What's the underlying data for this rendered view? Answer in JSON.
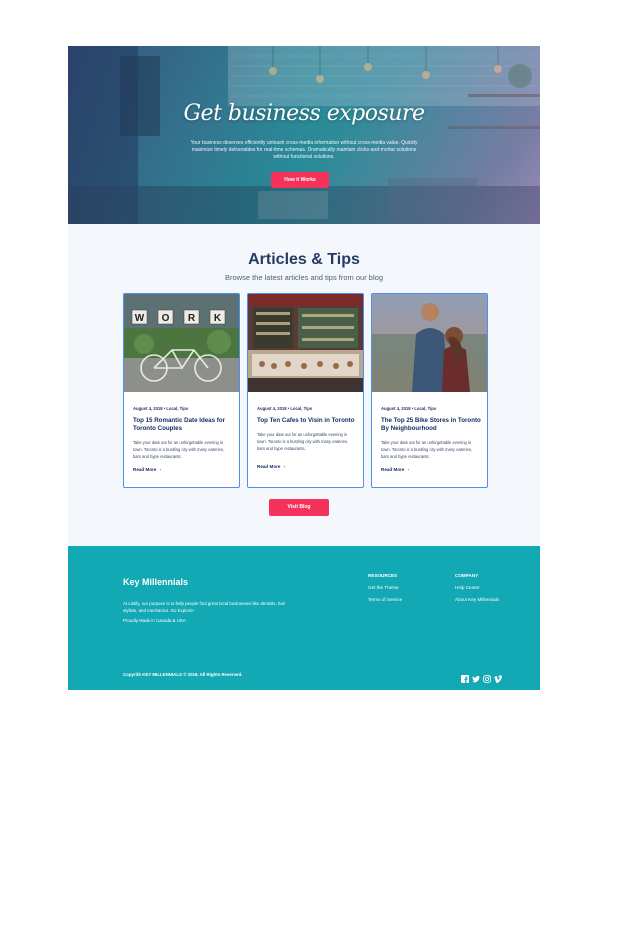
{
  "hero": {
    "title": "Get business exposure",
    "subtitle": "Your business deserves efficiently unleash cross-media information without cross-media value. Quickly maximize timely deliverables for real-time schemas. Dramatically maintain clicks-and-mortar solutions without functional solutions.",
    "button_label": "How it Works"
  },
  "articles": {
    "title": "Articles & Tips",
    "subtitle": "Browse the latest articles and tips from our blog",
    "cards": [
      {
        "meta": "August 4, 2018 • Local, Tips",
        "title": "Top 15 Romantic Date Ideas for Toronto Couples",
        "text": "Take your date out for an unforgettable evening in town. Toronto is a bustling city with many eateries, bars and hype restaurants.",
        "link": "Read More",
        "image_sign": "WORK"
      },
      {
        "meta": "August 4, 2018 • Local, Tips",
        "title": "Top Ten Cafes to Visin in Toronto",
        "text": "Take your date out for an unforgettable evening in town. Toronto is a bustling city with many eateries, bars and hype restaurants.",
        "link": "Read More"
      },
      {
        "meta": "August 4, 2018 • Local, Tips",
        "title": "The Top 25 Bike Stores in Toronto By Neighbourhood",
        "text": "Take your date out for an unforgettable evening in town. Toronto is a bustling city with many eateries, bars and hype restaurants.",
        "link": "Read More"
      }
    ],
    "button_label": "Visit Blog"
  },
  "footer": {
    "brand": "Key Millennials",
    "description": "At Listify, our purpose is to help people find great local businesses like dentists, hair stylists, and mechanics. Go Explore!",
    "made_in": "Proudly Made in Canada & USA",
    "resources": {
      "heading": "RESOURCES",
      "links": [
        "Get the Theme",
        "Terms of Service"
      ]
    },
    "company": {
      "heading": "COMPANY",
      "links": [
        "Help Center",
        "About Key Millennials"
      ]
    },
    "copyright": "Copyrith KEY MILLENNIALS © 2018. All Rights Reserved.",
    "socials": [
      "facebook-icon",
      "twitter-icon",
      "instagram-icon",
      "vimeo-icon"
    ]
  },
  "colors": {
    "accent": "#f5325c",
    "navy": "#263a64",
    "footer_bg": "#12a8b4",
    "card_border": "#4d8ff0"
  }
}
